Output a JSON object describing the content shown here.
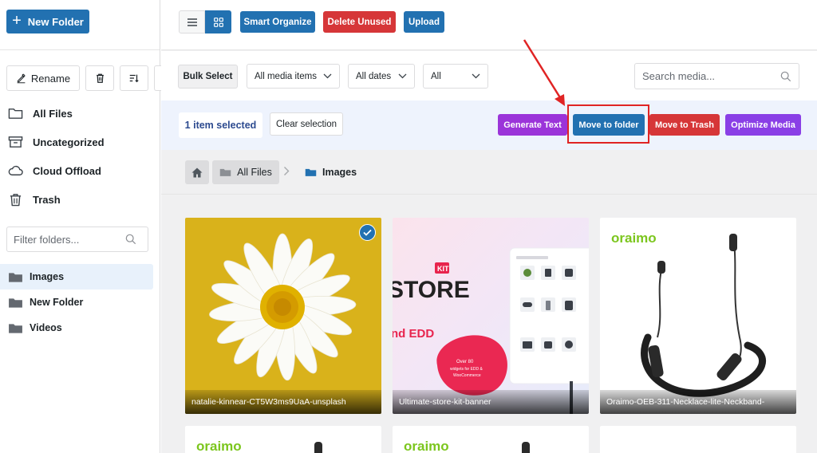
{
  "sidebar": {
    "new_folder_label": "New Folder",
    "rename_label": "Rename",
    "nav": [
      {
        "label": "All Files",
        "icon": "folder-outline-icon"
      },
      {
        "label": "Uncategorized",
        "icon": "archive-icon"
      },
      {
        "label": "Cloud Offload",
        "icon": "cloud-icon"
      },
      {
        "label": "Trash",
        "icon": "trash-icon"
      }
    ],
    "filter_placeholder": "Filter folders...",
    "folders": [
      {
        "label": "Images",
        "active": true
      },
      {
        "label": "New Folder",
        "active": false
      },
      {
        "label": "Videos",
        "active": false
      }
    ]
  },
  "toolbar": {
    "smart_organize": "Smart Organize",
    "delete_unused": "Delete Unused",
    "upload": "Upload"
  },
  "filters": {
    "bulk_select": "Bulk Select",
    "media_type": "All media items",
    "dates": "All dates",
    "all": "All",
    "search_placeholder": "Search media..."
  },
  "selection": {
    "count_label": "1 item selected",
    "clear_label": "Clear selection",
    "actions": {
      "generate_text": "Generate Text",
      "move_to_folder": "Move to folder",
      "move_to_trash": "Move to Trash",
      "optimize_media": "Optimize Media"
    }
  },
  "breadcrumb": {
    "root": "All Files",
    "current": "Images"
  },
  "media": [
    {
      "caption": "natalie-kinnear-CT5W3ms9UaA-unsplash",
      "selected": true
    },
    {
      "caption": "Ultimate-store-kit-banner",
      "selected": false
    },
    {
      "caption": "Oraimo-OEB-311-Necklace-lite-Neckband-",
      "selected": false
    }
  ],
  "banner": {
    "kit": "KIT",
    "store": "STORE",
    "edd": "nd EDD",
    "blob_line1": "Over 80",
    "blob_line2": "widgets for EDD &",
    "blob_line3": "WooCommerce"
  },
  "brand": {
    "oraimo": "oraimo"
  },
  "colors": {
    "primary": "#2271b1",
    "danger": "#d63638",
    "purple": "#9b34d9",
    "annotation": "#e02424",
    "flower_bg": "#d9b21b",
    "oraimo_green": "#7cc61e"
  }
}
